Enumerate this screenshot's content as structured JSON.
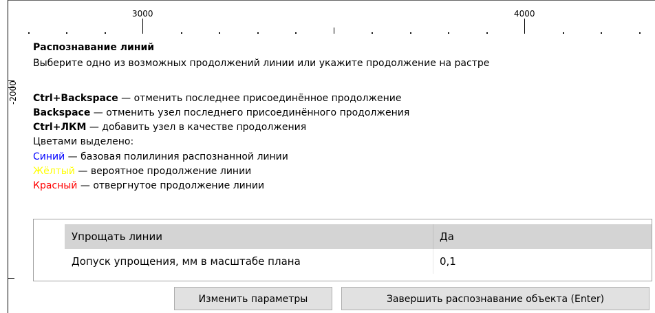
{
  "ruler": {
    "x_3000": "3000",
    "x_4000": "4000",
    "y_2000": "-2000"
  },
  "prompt": {
    "title": "Распознавание линий",
    "instruction": "Выберите одно из возможных продолжений линии или укажите продолжение на растре",
    "shortcuts": [
      {
        "key": "Ctrl+Backspace",
        "desc": " — отменить последнее присоединённое продолжение"
      },
      {
        "key": "Backspace",
        "desc": " — отменить узел последнего присоединённого продолжения"
      },
      {
        "key": "Ctrl+ЛКМ",
        "desc": " — добавить узел в качестве продолжения"
      }
    ],
    "legend_title": "Цветами выделено:",
    "legend": [
      {
        "color_name": "Синий",
        "desc": " — базовая полилиния распознанной линии",
        "color": "#0000ff"
      },
      {
        "color_name": "Жёлтый",
        "desc": " — вероятное продолжение линии",
        "color": "#ffff00"
      },
      {
        "color_name": "Красный",
        "desc": " — отвергнутое продолжение линии",
        "color": "#ff0000"
      }
    ]
  },
  "params": {
    "rows": [
      {
        "name": "Упрощать линии",
        "value": "Да"
      },
      {
        "name": "Допуск упрощения, мм в масштабе плана",
        "value": "0,1"
      }
    ]
  },
  "buttons": {
    "change_params": "Изменить параметры",
    "finish": "Завершить распознавание объекта (Enter)"
  }
}
